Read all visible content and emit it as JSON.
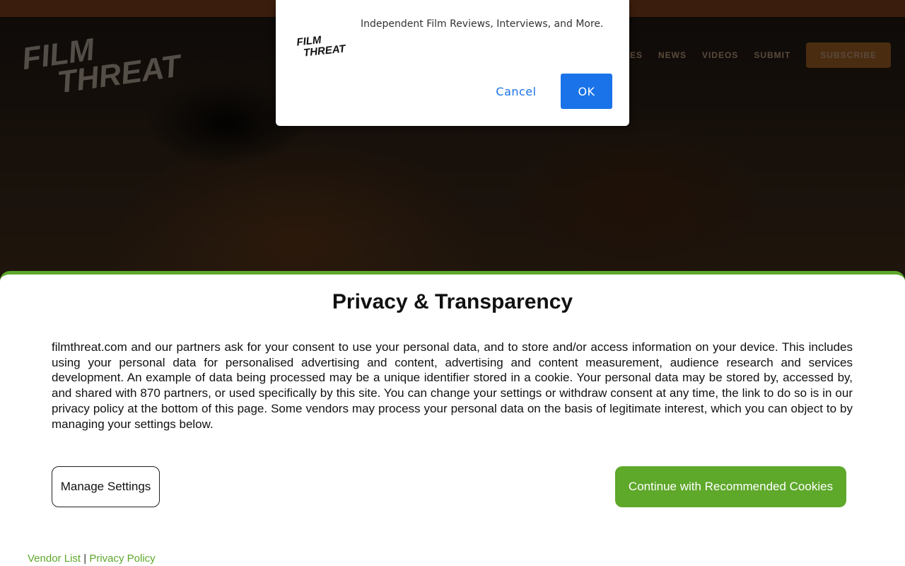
{
  "site": {
    "nav": [
      "FEATURES",
      "NEWS",
      "VIDEOS",
      "SUBMIT"
    ],
    "subscribe_label": "SUBSCRIBE"
  },
  "notification": {
    "message": "Independent Film Reviews, Interviews, and More.",
    "cancel_label": "Cancel",
    "ok_label": "OK"
  },
  "consent": {
    "title": "Privacy & Transparency",
    "body": "filmthreat.com and our partners ask for your consent to use your personal data, and to store and/or access information on your device. This includes using your personal data for personalised advertising and content, advertising and content measurement, audience research and services development. An example of data being processed may be a unique identifier stored in a cookie. Your personal data may be stored by, accessed by, and shared with 870 partners, or used specifically by this site. You can change your settings or withdraw consent at any time, the link to do so is in our privacy policy at the bottom of this page. Some vendors may process your personal data on the basis of legitimate interest, which you can object to by managing your settings below.",
    "manage_label": "Manage Settings",
    "continue_label": "Continue with Recommended Cookies",
    "vendor_list_label": "Vendor List",
    "separator": "|",
    "privacy_policy_label": "Privacy Policy"
  },
  "colors": {
    "accent_green": "#5ea82a",
    "ok_blue": "#1a73e8"
  },
  "logo_text": [
    "FILM",
    "THREAT"
  ]
}
